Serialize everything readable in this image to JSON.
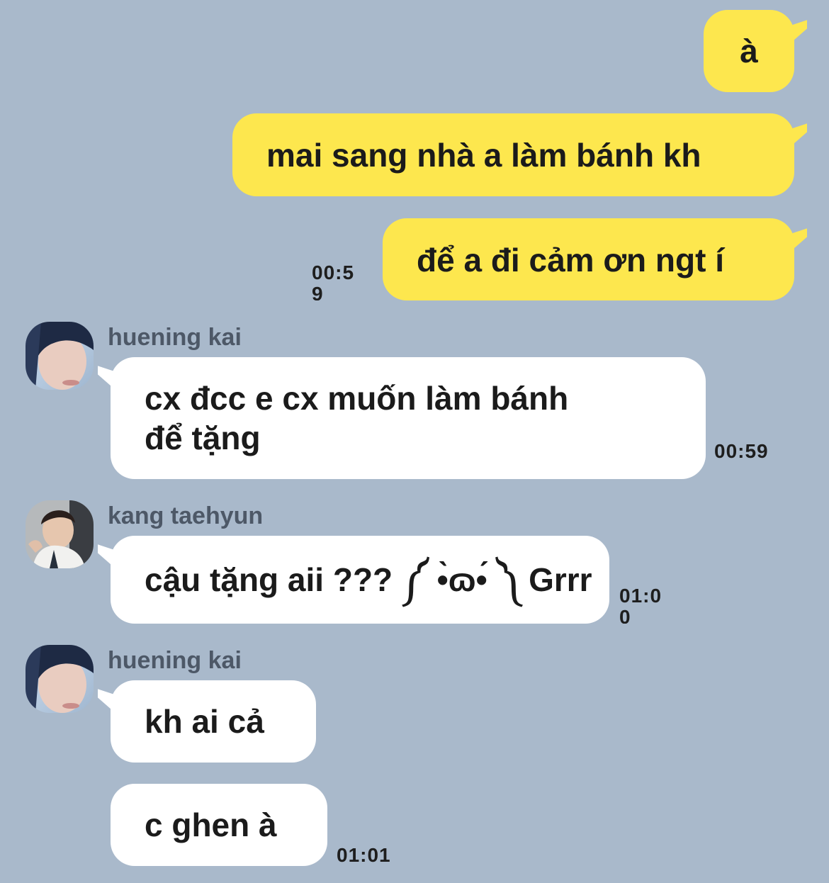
{
  "colors": {
    "background": "#a9b9cb",
    "outgoing_bubble": "#fde74e",
    "incoming_bubble": "#ffffff",
    "sender_name": "#4d5867",
    "text": "#1b1b1b"
  },
  "messages": {
    "out1": {
      "text": "à"
    },
    "out2": {
      "text": "mai sang nhà a làm bánh kh"
    },
    "out3": {
      "text": "để a đi cảm ơn ngt í",
      "time": "00:59"
    },
    "in1": {
      "sender": "huening kai",
      "avatar": "huening-kai-avatar-icon",
      "text_line1": "cx đcc e cx muốn làm bánh",
      "text_line2": "để tặng",
      "time": "00:59"
    },
    "in2": {
      "sender": "kang taehyun",
      "avatar": "kang-taehyun-avatar-icon",
      "text": "cậu tặng aii ??? ༼ •̀ɷ•́ ༽ Grrr",
      "time": "01:00"
    },
    "in3": {
      "sender": "huening kai",
      "avatar": "huening-kai-avatar-icon",
      "text": "kh ai cả"
    },
    "in4": {
      "text": "c ghen à",
      "time": "01:01"
    }
  }
}
